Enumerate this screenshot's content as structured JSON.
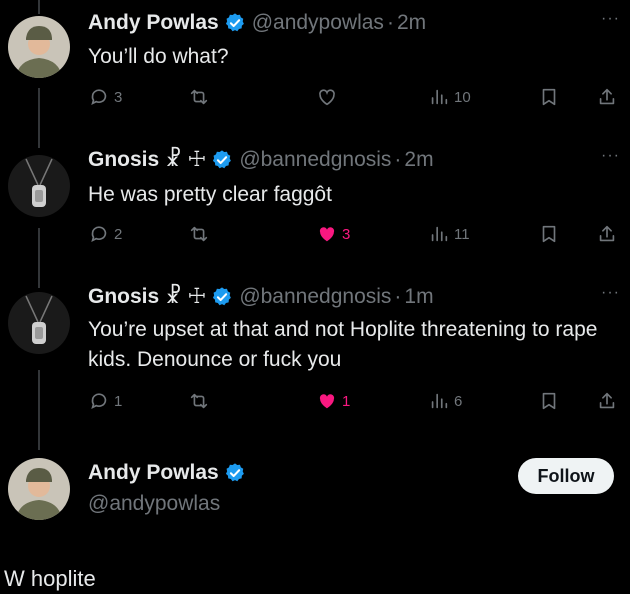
{
  "colors": {
    "background": "#000000",
    "text": "#e7e9ea",
    "muted": "#71767b",
    "verified": "#1d9bf0",
    "like": "#f91880"
  },
  "tweets": [
    {
      "name": "Andy Powlas",
      "glyphs": "",
      "handle": "@andypowlas",
      "time": "2m",
      "text": "You’ll do what?",
      "replies": "3",
      "reposts": "",
      "likes": "",
      "liked": false,
      "views": "10"
    },
    {
      "name": "Gnosis",
      "glyphs": "☧ ☩",
      "handle": "@bannedgnosis",
      "time": "2m",
      "text": "He was pretty clear faggôt",
      "replies": "2",
      "reposts": "",
      "likes": "3",
      "liked": true,
      "views": "11"
    },
    {
      "name": "Gnosis",
      "glyphs": "☧ ☩",
      "handle": "@bannedgnosis",
      "time": "1m",
      "text": "You’re upset at that and not Hoplite threatening to rape kids. Denounce or fuck you",
      "replies": "1",
      "reposts": "",
      "likes": "1",
      "liked": true,
      "views": "6"
    }
  ],
  "profile_card": {
    "name": "Andy Powlas",
    "handle": "@andypowlas",
    "follow_label": "Follow"
  },
  "comment": "W hoplite",
  "dot": "·",
  "more": "···"
}
